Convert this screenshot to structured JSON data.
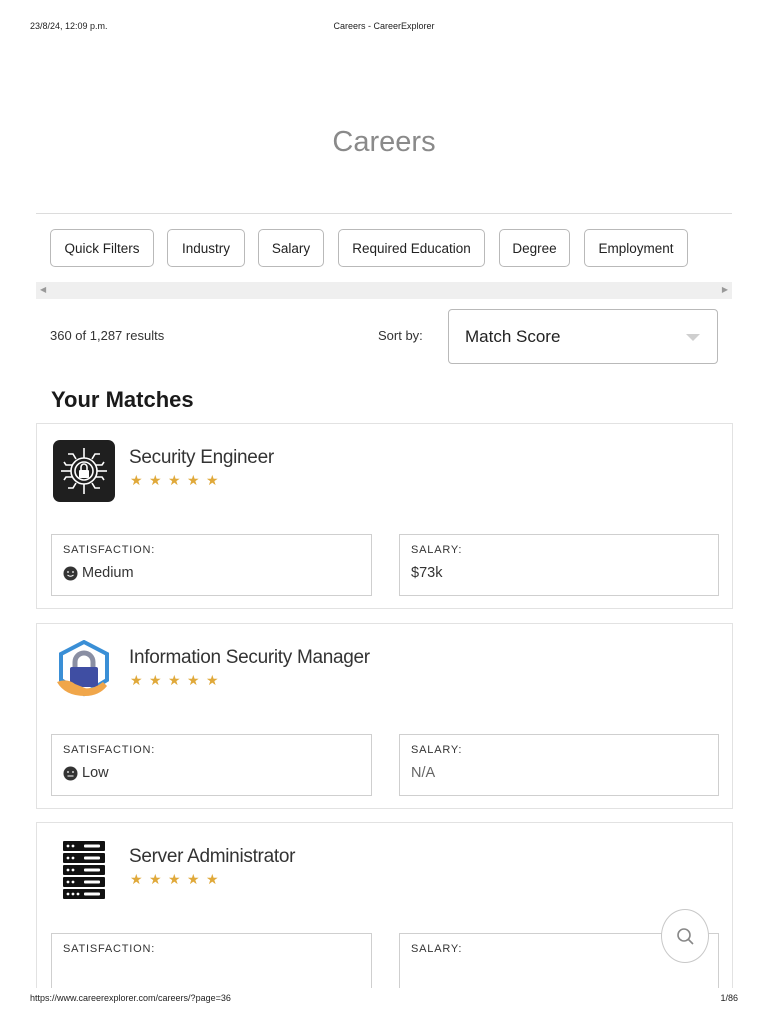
{
  "print_header": {
    "date": "23/8/24, 12:09 p.m.",
    "title": "Careers - CareerExplorer"
  },
  "page_title": "Careers",
  "filters": [
    {
      "label": "Quick Filters"
    },
    {
      "label": "Industry"
    },
    {
      "label": "Salary"
    },
    {
      "label": "Required Education"
    },
    {
      "label": "Degree"
    },
    {
      "label": "Employment"
    }
  ],
  "results": {
    "count_text": "360 of 1,287 results",
    "sort_label": "Sort by:",
    "sort_value": "Match Score"
  },
  "section_heading": "Your Matches",
  "careers": [
    {
      "name": "Security Engineer",
      "stars": 5,
      "satisfaction_label": "SATISFACTION:",
      "satisfaction_value": "Medium",
      "salary_label": "SALARY:",
      "salary_value": "$73k",
      "icon": "security-chip-icon"
    },
    {
      "name": "Information Security Manager",
      "stars": 5,
      "satisfaction_label": "SATISFACTION:",
      "satisfaction_value": "Low",
      "salary_label": "SALARY:",
      "salary_value": "N/A",
      "icon": "padlock-hand-icon"
    },
    {
      "name": "Server Administrator",
      "stars": 5,
      "satisfaction_label": "SATISFACTION:",
      "satisfaction_value": "",
      "salary_label": "SALARY:",
      "salary_value": "",
      "icon": "server-rack-icon"
    }
  ],
  "print_footer": {
    "url": "https://www.careerexplorer.com/careers/?page=36",
    "page": "1/86"
  },
  "colors": {
    "star": "#e0a93a",
    "title_grey": "#8a8a8a",
    "border": "#cfcfcf",
    "scrollbar": "#efefef"
  }
}
